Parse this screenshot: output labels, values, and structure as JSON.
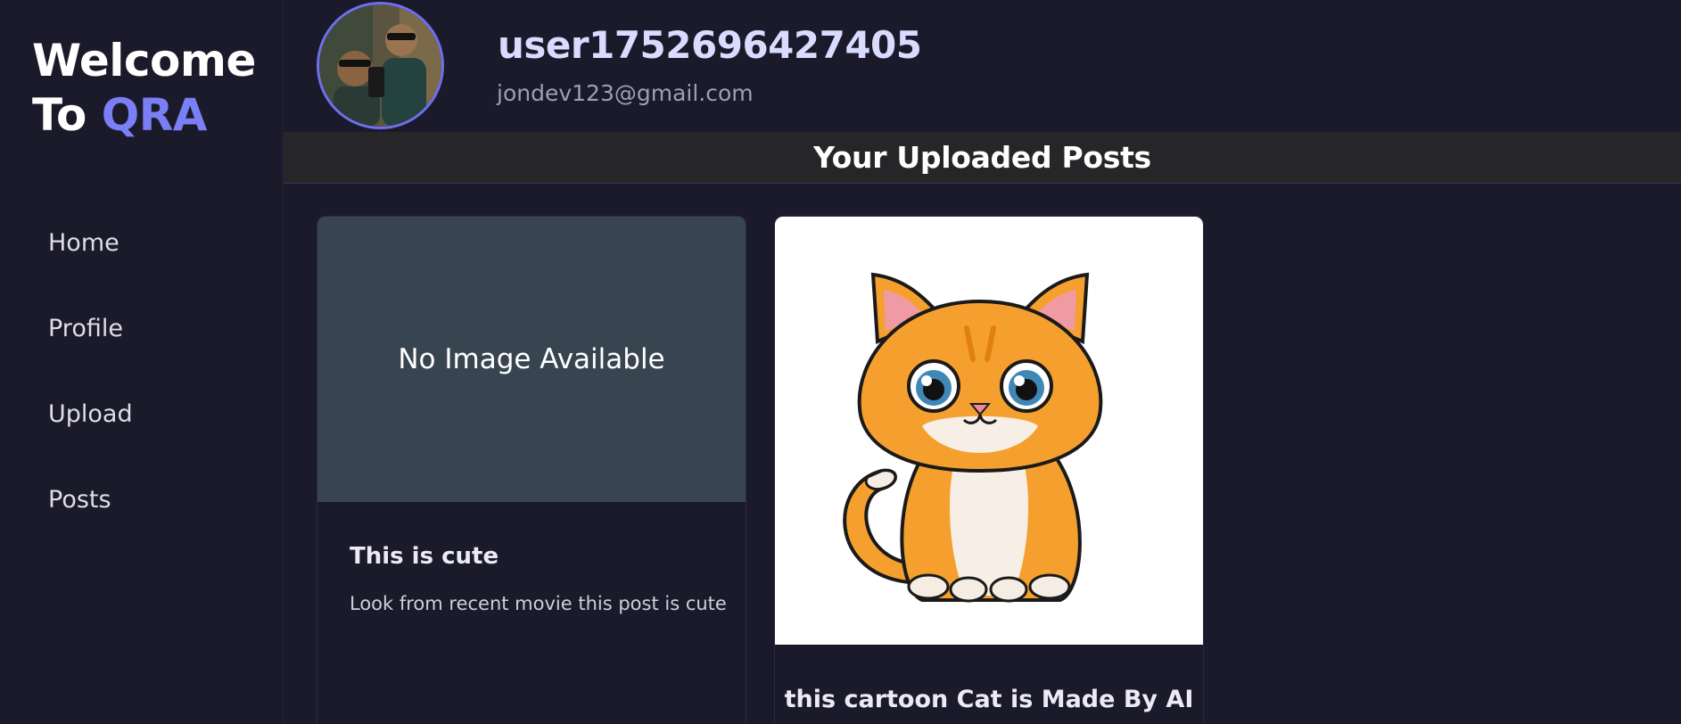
{
  "brand": {
    "line1": "Welcome",
    "line2_prefix": "To ",
    "line2_accent": "QRA"
  },
  "nav": {
    "items": [
      {
        "label": "Home"
      },
      {
        "label": "Profile"
      },
      {
        "label": "Upload"
      },
      {
        "label": "Posts"
      }
    ]
  },
  "profile": {
    "username": "user1752696427405",
    "email": "jondev123@gmail.com"
  },
  "posts_section": {
    "title": "Your Uploaded Posts"
  },
  "posts": [
    {
      "image_placeholder": "No Image Available",
      "title": "This is cute",
      "description": "Look from recent movie this post is cute"
    },
    {
      "title": "this cartoon Cat is Made By AI"
    }
  ],
  "colors": {
    "background": "#1b1a2b",
    "accent": "#7b7ff5",
    "avatar_ring": "#6e6ff0",
    "title_bar": "#262628",
    "placeholder": "#384551"
  }
}
